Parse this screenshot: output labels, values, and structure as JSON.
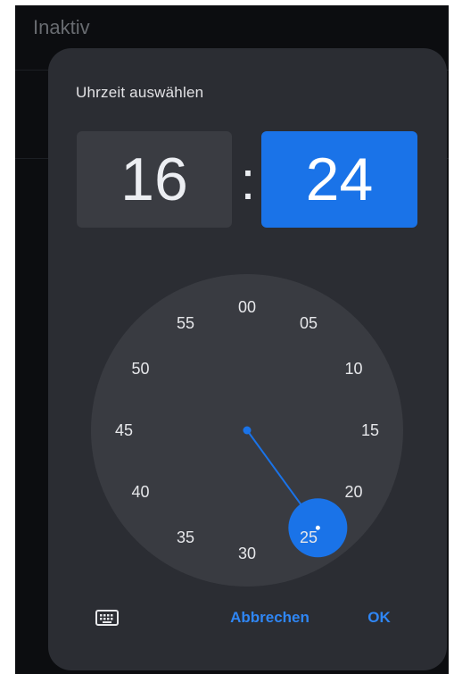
{
  "background": {
    "title": "Inaktiv"
  },
  "dialog": {
    "title": "Uhrzeit auswählen",
    "hour": "16",
    "separator": ":",
    "minute": "24",
    "cancel_label": "Abbrechen",
    "ok_label": "OK"
  },
  "clock": {
    "labels": [
      "00",
      "05",
      "10",
      "15",
      "20",
      "25",
      "30",
      "35",
      "40",
      "45",
      "50",
      "55"
    ],
    "selected_minute": 24
  },
  "colors": {
    "accent": "#1a73e8",
    "dialog_bg": "#2b2d33",
    "clock_face": "#393b41"
  },
  "icons": {
    "keyboard": "keyboard-icon"
  }
}
